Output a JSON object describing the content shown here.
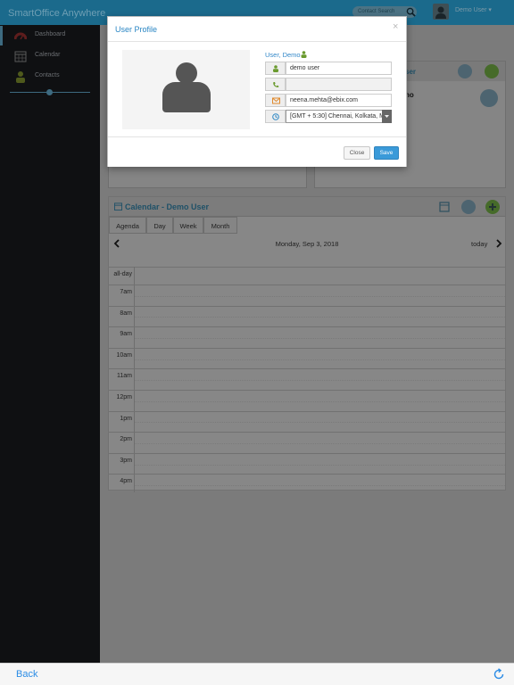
{
  "app": {
    "brand": "SmartOffice Anywhere"
  },
  "header": {
    "search_placeholder": "Contact Search",
    "user_menu": "Demo User ▾"
  },
  "sidebar": {
    "items": [
      {
        "label": "Dashboard",
        "icon": "speedometer-icon"
      },
      {
        "label": "Calendar",
        "icon": "calendar-icon"
      },
      {
        "label": "Contacts",
        "icon": "person-icon"
      }
    ]
  },
  "background": {
    "top_right_ghost_text": "ser",
    "top_right_ghost_text2": "no"
  },
  "calendar": {
    "title": "Calendar - Demo User",
    "views": [
      "Agenda",
      "Day",
      "Week",
      "Month"
    ],
    "date_label": "Monday, Sep 3, 2018",
    "today_label": "today",
    "all_day_label": "all-day",
    "hours": [
      "7am",
      "8am",
      "9am",
      "10am",
      "11am",
      "12pm",
      "1pm",
      "2pm",
      "3pm",
      "4pm"
    ]
  },
  "modal": {
    "title": "User Profile",
    "close_x": "×",
    "user_name": "User, Demo",
    "fields": {
      "display_name": "demo user",
      "phone": "",
      "email": "neena.mehta@ebix.com",
      "timezone": "[GMT + 5:30] Chennai, Kolkata, M"
    },
    "buttons": {
      "close": "Close",
      "save": "Save"
    }
  },
  "bottom": {
    "back": "Back"
  },
  "colors": {
    "accent": "#2a86c4",
    "topbar": "#1b6a8c",
    "save": "#3a9ad9",
    "sidebar": "#0f1012"
  }
}
